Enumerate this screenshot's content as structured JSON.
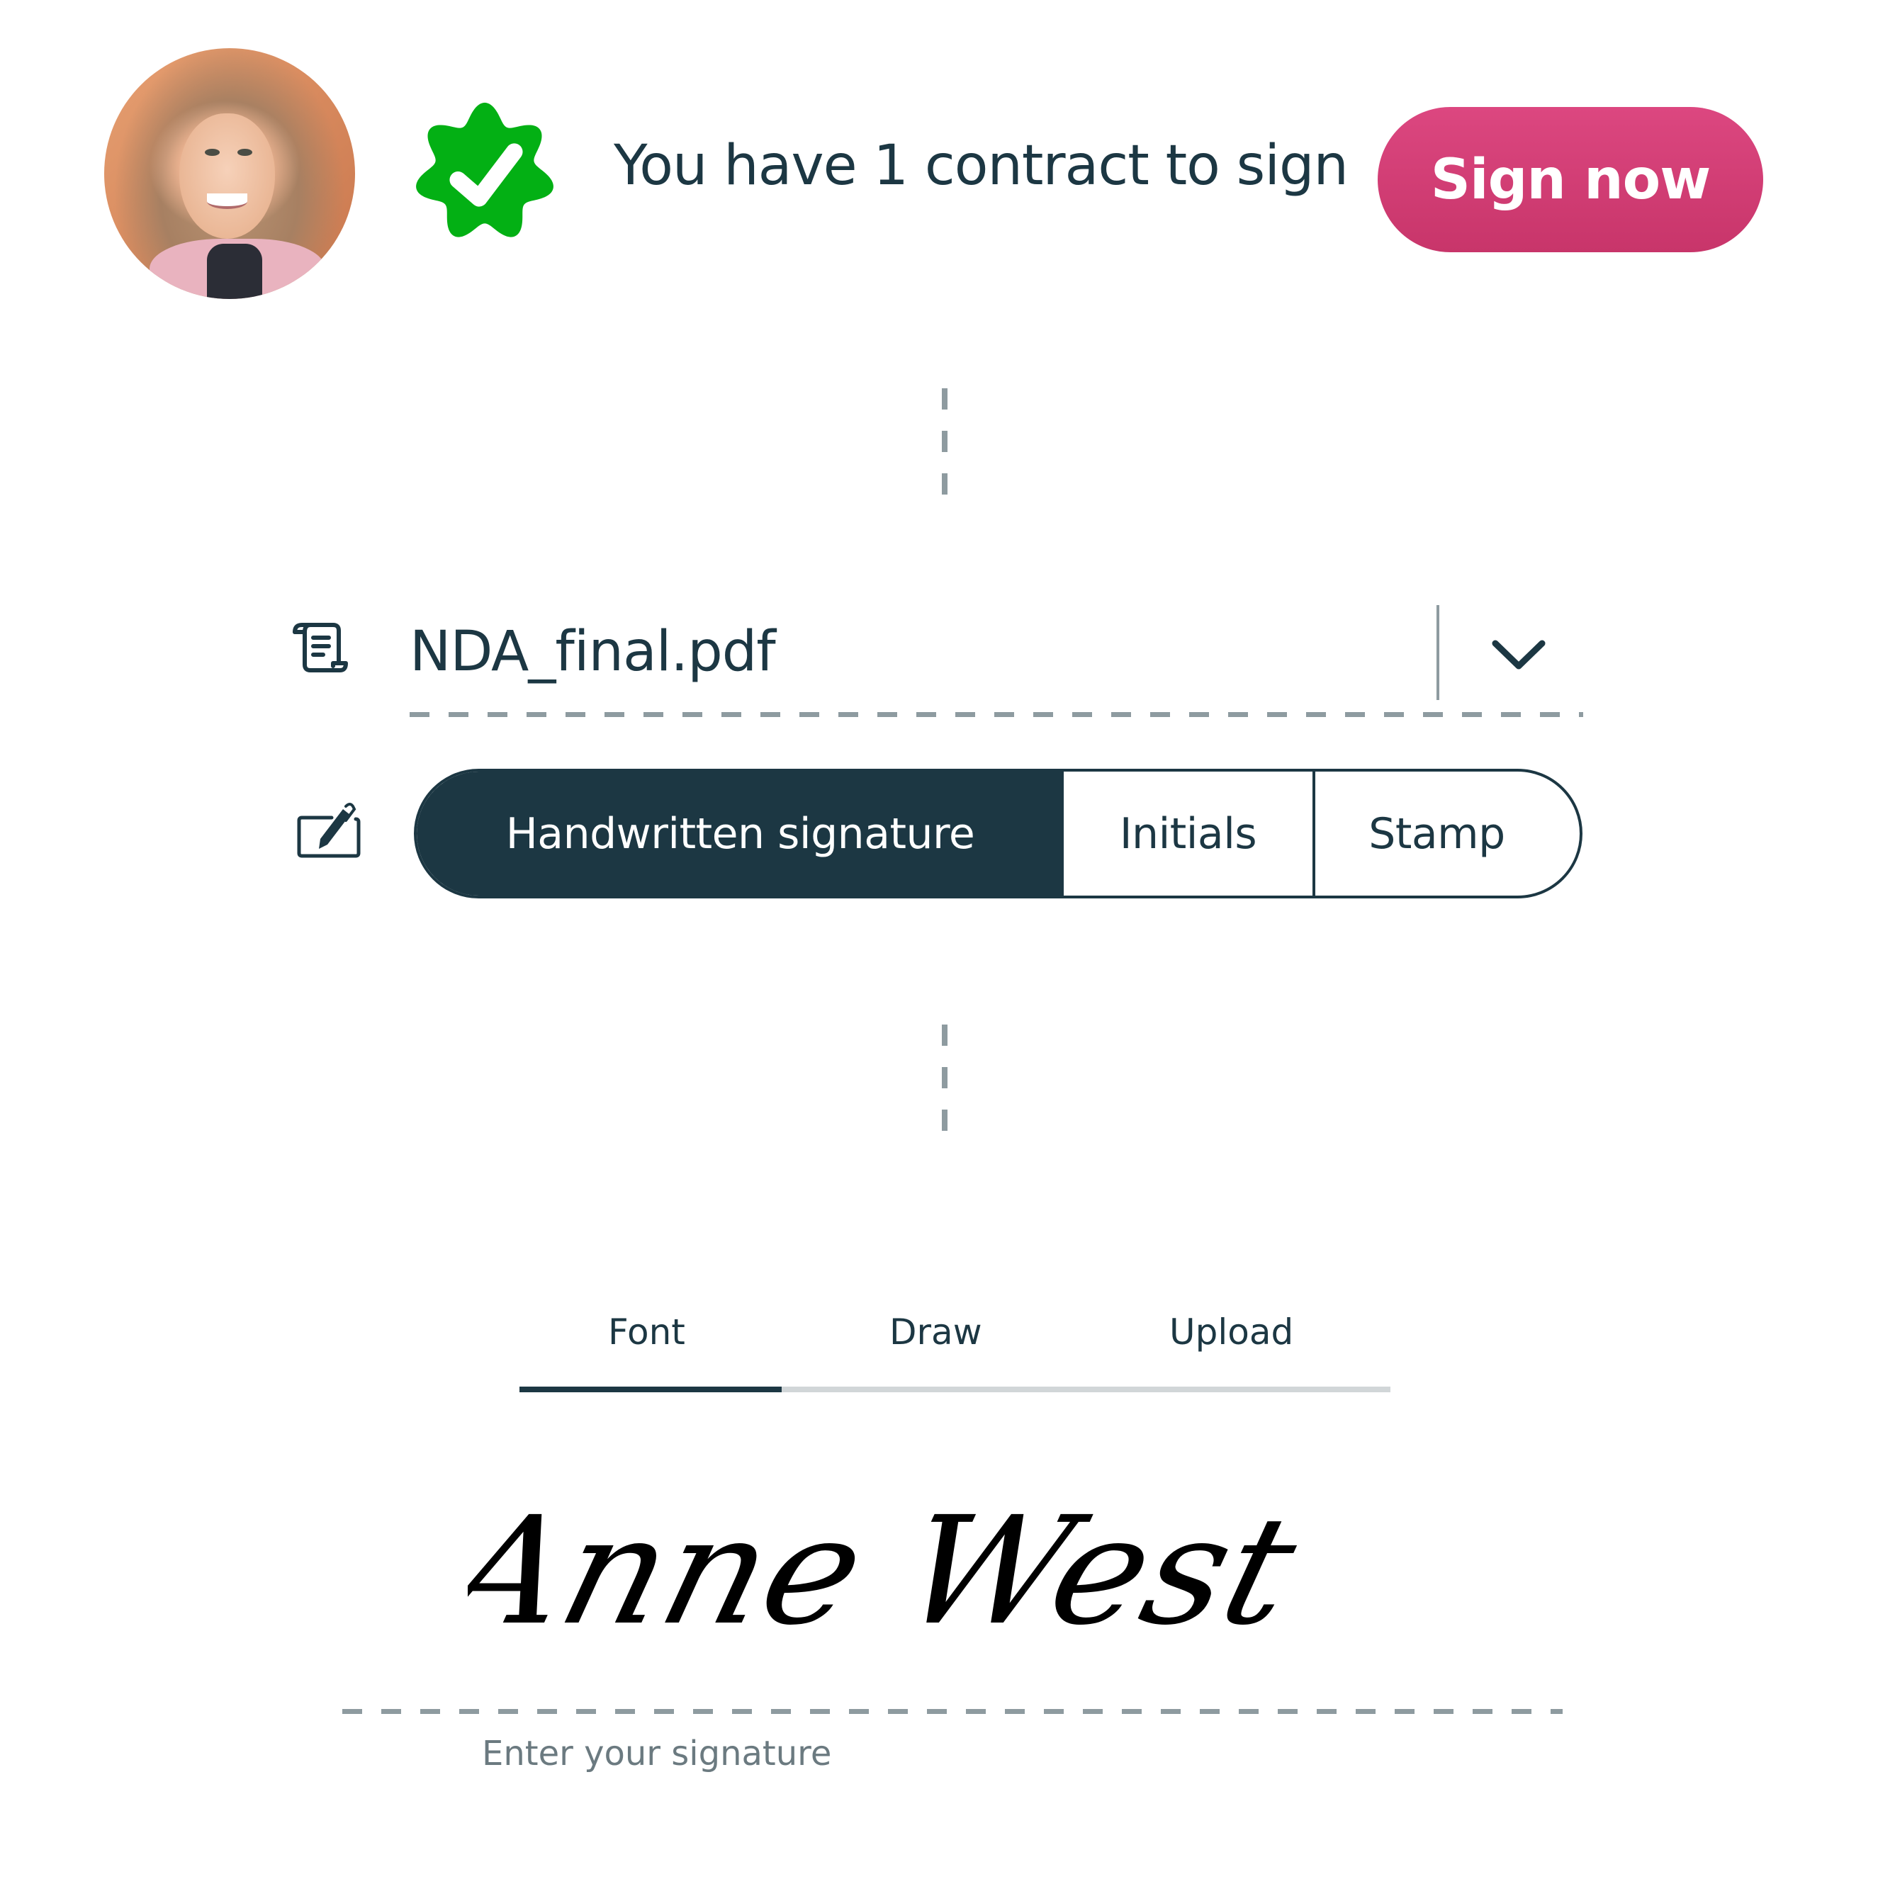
{
  "header": {
    "avatar_alt": "User profile photo",
    "badge_icon": "verified-badge-icon",
    "message": "You have 1 contract to sign",
    "sign_now_label": "Sign now"
  },
  "document": {
    "icon": "scroll-document-icon",
    "file_name": "NDA_final.pdf",
    "dropdown_icon": "chevron-down-icon"
  },
  "signature_type": {
    "icon": "pen-signature-icon",
    "options": [
      {
        "label": "Handwritten signature",
        "selected": true
      },
      {
        "label": "Initials",
        "selected": false
      },
      {
        "label": "Stamp",
        "selected": false
      }
    ]
  },
  "signature_method": {
    "tabs": [
      {
        "label": "Font",
        "active": true
      },
      {
        "label": "Draw",
        "active": false
      },
      {
        "label": "Upload",
        "active": false
      }
    ]
  },
  "signature_field": {
    "value": "Anne West",
    "placeholder": "Enter your signature"
  },
  "colors": {
    "primary_dark": "#1c3743",
    "accent_pink": "#d4407a",
    "badge_green": "#03b014",
    "dash_gray": "#8e9ba0",
    "muted_text": "#6b7a80"
  }
}
